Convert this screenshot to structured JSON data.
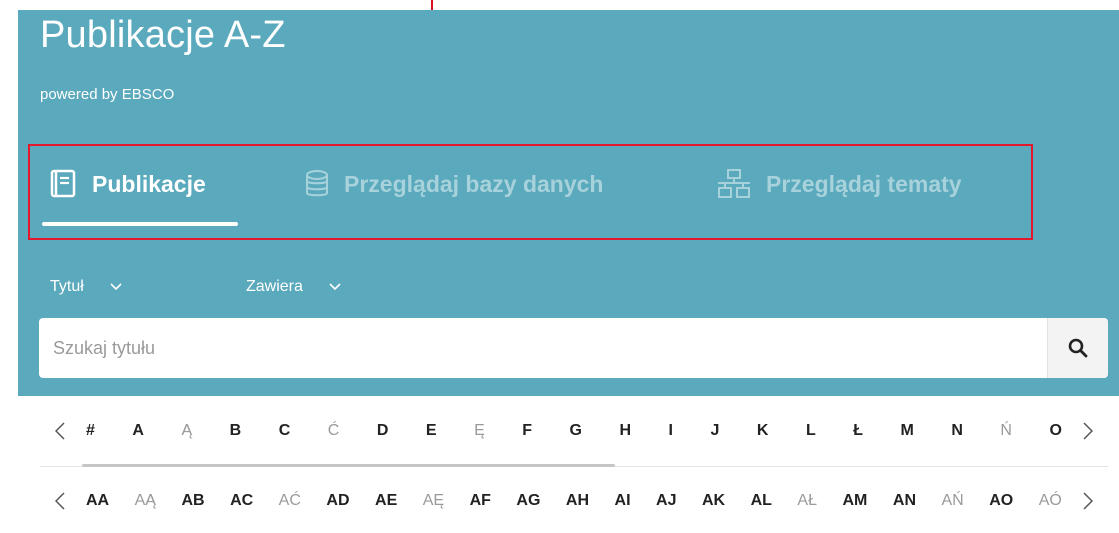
{
  "header": {
    "title": "Publikacje A-Z",
    "subtitle": "powered by EBSCO"
  },
  "tabs": [
    {
      "label": "Publikacje",
      "icon": "book-icon",
      "active": true
    },
    {
      "label": "Przeglądaj bazy danych",
      "icon": "database-icon",
      "active": false
    },
    {
      "label": "Przeglądaj tematy",
      "icon": "sitemap-icon",
      "active": false
    }
  ],
  "filters": {
    "field": "Tytuł",
    "match": "Zawiera"
  },
  "search": {
    "placeholder": "Szukaj tytułu",
    "value": ""
  },
  "alphabet_row1": [
    {
      "label": "#",
      "dim": false
    },
    {
      "label": "A",
      "dim": false
    },
    {
      "label": "Ą",
      "dim": true
    },
    {
      "label": "B",
      "dim": false
    },
    {
      "label": "C",
      "dim": false
    },
    {
      "label": "Ć",
      "dim": true
    },
    {
      "label": "D",
      "dim": false
    },
    {
      "label": "E",
      "dim": false
    },
    {
      "label": "Ę",
      "dim": true
    },
    {
      "label": "F",
      "dim": false
    },
    {
      "label": "G",
      "dim": false
    },
    {
      "label": "H",
      "dim": false
    },
    {
      "label": "I",
      "dim": false
    },
    {
      "label": "J",
      "dim": false
    },
    {
      "label": "K",
      "dim": false
    },
    {
      "label": "L",
      "dim": false
    },
    {
      "label": "Ł",
      "dim": false
    },
    {
      "label": "M",
      "dim": false
    },
    {
      "label": "N",
      "dim": false
    },
    {
      "label": "Ń",
      "dim": true
    },
    {
      "label": "O",
      "dim": false
    }
  ],
  "alphabet_row2": [
    {
      "label": "AA",
      "dim": false
    },
    {
      "label": "AĄ",
      "dim": true
    },
    {
      "label": "AB",
      "dim": false
    },
    {
      "label": "AC",
      "dim": false
    },
    {
      "label": "AĆ",
      "dim": true
    },
    {
      "label": "AD",
      "dim": false
    },
    {
      "label": "AE",
      "dim": false
    },
    {
      "label": "AĘ",
      "dim": true
    },
    {
      "label": "AF",
      "dim": false
    },
    {
      "label": "AG",
      "dim": false
    },
    {
      "label": "AH",
      "dim": false
    },
    {
      "label": "AI",
      "dim": false
    },
    {
      "label": "AJ",
      "dim": false
    },
    {
      "label": "AK",
      "dim": false
    },
    {
      "label": "AL",
      "dim": false
    },
    {
      "label": "AŁ",
      "dim": true
    },
    {
      "label": "AM",
      "dim": false
    },
    {
      "label": "AN",
      "dim": false
    },
    {
      "label": "AŃ",
      "dim": true
    },
    {
      "label": "AO",
      "dim": false
    },
    {
      "label": "AÓ",
      "dim": true
    }
  ],
  "colors": {
    "hero_bg": "#5aa9bc",
    "highlight_border": "#e3182d",
    "annotation_arrow": "#d8141e",
    "inactive_tab": "#a7d2dc"
  },
  "annotation": {
    "icon": "arrow-down-icon"
  }
}
